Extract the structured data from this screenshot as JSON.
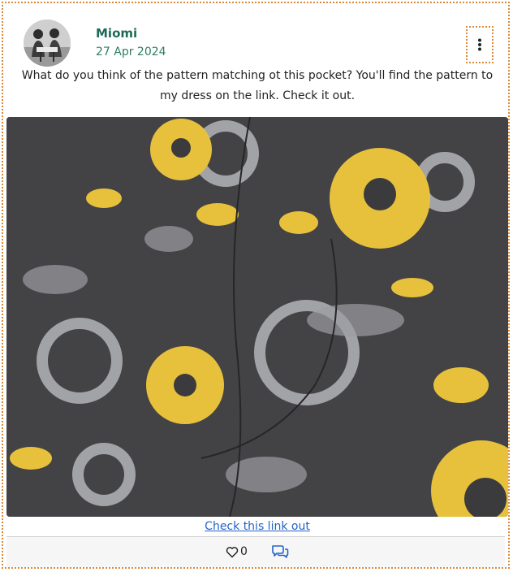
{
  "post": {
    "author": "Miomi",
    "date": "27 Apr 2024",
    "caption_line1": "What do you think of the pattern matching ot this pocket? You'll find the pattern to",
    "caption_line2": "my dress on the link. Check it out.",
    "link_text": "Check this link out",
    "like_count": "0"
  },
  "icons": {
    "menu": "more-vertical-icon",
    "like": "heart-outline-icon",
    "comment": "comments-icon"
  },
  "colors": {
    "accent": "#1f6b57",
    "link": "#2463c7",
    "border": "#d98a3a",
    "fabric_dark": "#464648",
    "fabric_yellow": "#e8c13c",
    "fabric_grey": "#b3b4b8"
  }
}
